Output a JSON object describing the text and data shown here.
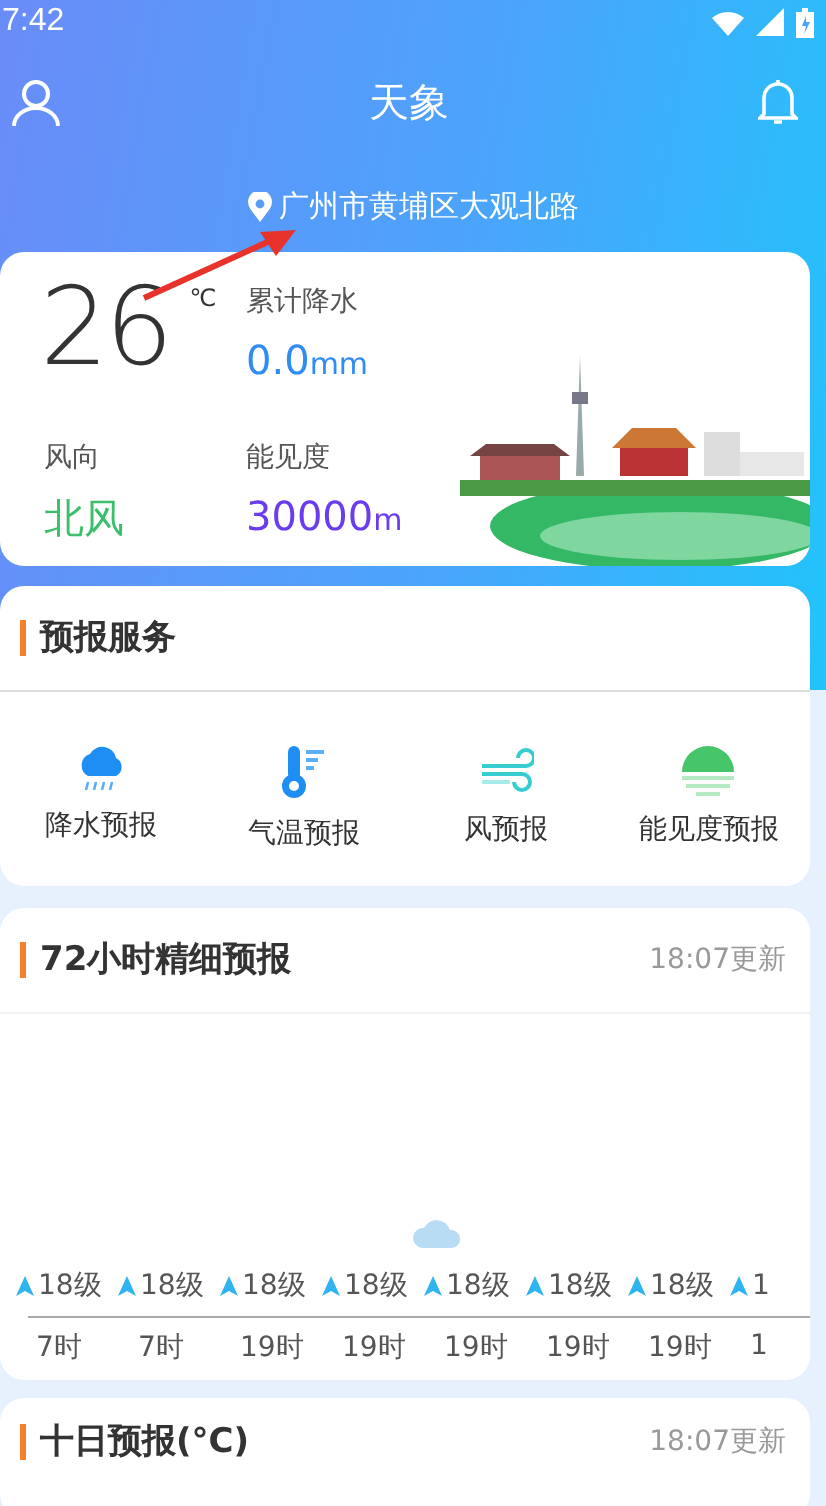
{
  "status_bar": {
    "time": "7:42"
  },
  "header": {
    "title": "天象",
    "location": "广州市黄埔区大观北路"
  },
  "current": {
    "temperature": "26",
    "unit": "℃",
    "stats": [
      {
        "label": "累计降水",
        "value": "0.0",
        "unit": "mm",
        "color": "#2f8cf5"
      },
      {
        "label": "风向",
        "value": "北风",
        "color": "#3cbf6a"
      },
      {
        "label": "能见度",
        "value": "30000",
        "unit": "m",
        "color": "#6a3cf0"
      }
    ]
  },
  "services": {
    "title": "预报服务",
    "items": [
      {
        "kind": "rain",
        "label": "降水预报"
      },
      {
        "kind": "temp",
        "label": "气温预报"
      },
      {
        "kind": "wind",
        "label": "风预报"
      },
      {
        "kind": "visibility",
        "label": "能见度预报"
      }
    ]
  },
  "hourly": {
    "title": "72小时精细预报",
    "updated": "18:07更新",
    "items": [
      {
        "wind": "18级",
        "time": "7时"
      },
      {
        "wind": "18级",
        "time": "7时"
      },
      {
        "wind": "18级",
        "time": "19时"
      },
      {
        "wind": "18级",
        "time": "19时"
      },
      {
        "wind": "18级",
        "time": "19时"
      },
      {
        "wind": "18级",
        "time": "19时"
      },
      {
        "wind": "18级",
        "time": "19时"
      },
      {
        "wind": "1",
        "time": "1"
      }
    ]
  },
  "ten_day": {
    "title": "十日预报(°C)",
    "updated": "18:07更新"
  }
}
